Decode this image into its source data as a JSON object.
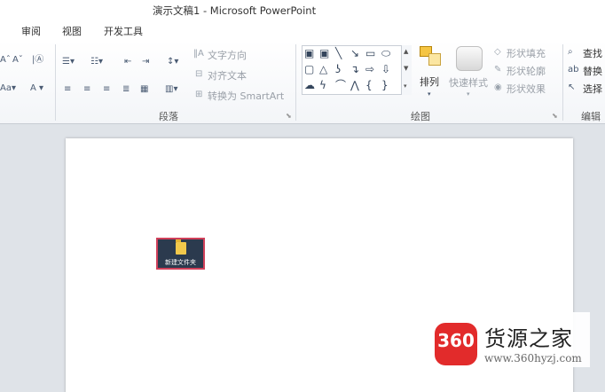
{
  "window": {
    "title": "演示文稿1 - Microsoft PowerPoint"
  },
  "tabs": [
    "审阅",
    "视图",
    "开发工具"
  ],
  "ribbon": {
    "paragraph": {
      "label": "段落",
      "text_direction": "文字方向",
      "align_text": "对齐文本",
      "convert_smartart": "转换为 SmartArt"
    },
    "drawing": {
      "label": "绘图",
      "arrange": "排列",
      "quick_styles": "快速样式",
      "shape_fill": "形状填充",
      "shape_outline": "形状轮廓",
      "shape_effects": "形状效果"
    },
    "editing": {
      "label": "编辑",
      "find": "查找",
      "replace": "替换",
      "select": "选择"
    }
  },
  "slide": {
    "folder_label": "新建文件夹"
  },
  "watermark": {
    "logo": "360",
    "name": "货源之家",
    "url": "www.360hyzj.com"
  }
}
